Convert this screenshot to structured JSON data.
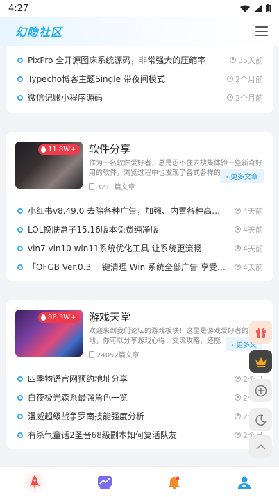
{
  "status_bar": {
    "time": "4:27"
  },
  "header": {
    "logo": "幻隐社区",
    "menu_icon": "hamburger-menu-icon"
  },
  "top_list": [
    {
      "title": "PixPro 全开源图床系统源码，非常强大的压缩率",
      "time": "35天前"
    },
    {
      "title": "Typecho博客主题Single 带夜间模式",
      "time": "2个月前"
    },
    {
      "title": "微信记账小程序源码",
      "time": "2个月前"
    }
  ],
  "categories": [
    {
      "name": "软件分享",
      "hot": "11.8W+",
      "description": "作为一名软件爱好者，总是忍不住去搜集体验一些新奇好用的软件，浏览过程中也发现了各式各样的软…",
      "count": "3211篇文章",
      "more": "更多文章",
      "items": [
        {
          "title": "小红书v8.49.0 去除各种广告，加强、内置各种高级…",
          "time": "4天前"
        },
        {
          "title": "LOL换肤盒子15.16版本免费纯净版",
          "time": "4天前"
        },
        {
          "title": "vin7 vin10 win11系统优化工具 让系统更流畅",
          "time": "4天前"
        },
        {
          "title": "「OFGB Ver.0.3 一键清理 Win 系统全部广告 享受超…",
          "time": "4天前"
        }
      ]
    },
    {
      "name": "游戏天堂",
      "hot": "86.3W+",
      "description": "欢迎来到我们论坛的游戏板块！这里是游戏爱好者的聚集地，你可以分享游戏心得、交流攻略，还能",
      "count": "24052篇文章",
      "more": "更多文",
      "items": [
        {
          "title": "四季物语官网预约地址分享",
          "time": "2个月"
        },
        {
          "title": "白夜极光森系最强角色一览",
          "time": "2个月"
        },
        {
          "title": "漫威超级战争罗南技能强度分析",
          "time": "2个月"
        },
        {
          "title": "有杀气童话2圣音68级副本如何复活队友",
          "time": "2个月"
        }
      ]
    }
  ],
  "float_buttons": [
    "gift-icon",
    "crown-icon",
    "plus-circle-icon",
    "moon-icon",
    "back-to-top-icon"
  ],
  "tabbar": [
    "home-rocket-icon",
    "chart-icon",
    "notification-bell-icon",
    "user-icon"
  ],
  "colors": {
    "accent": "#3aa9f5",
    "hot": "#f03a4a",
    "logo": "#23aef0"
  }
}
